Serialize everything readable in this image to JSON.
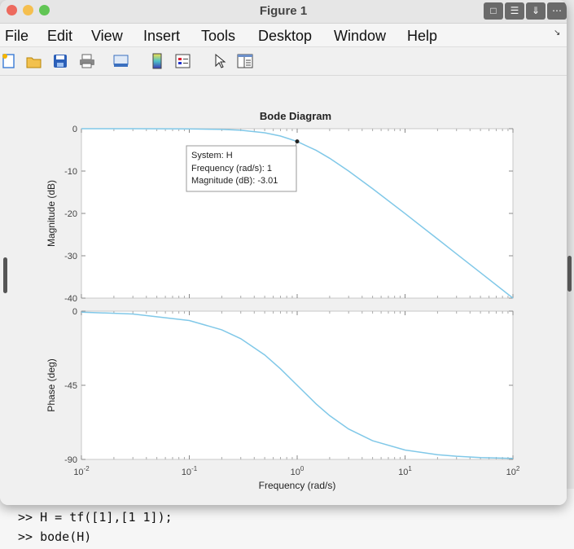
{
  "window": {
    "title": "Figure 1",
    "traffic_lights": [
      "#ed6a5e",
      "#f5bf4f",
      "#61c554"
    ],
    "title_buttons": [
      "comment-icon",
      "list-icon",
      "download-icon",
      "more-icon"
    ]
  },
  "menu": [
    "File",
    "Edit",
    "View",
    "Insert",
    "Tools",
    "Desktop",
    "Window",
    "Help"
  ],
  "toolbar_icons": [
    "new-figure-icon",
    "open-file-icon",
    "save-icon",
    "print-icon",
    "link-plot-icon",
    "colorbar-icon",
    "legend-icon",
    "pointer-icon",
    "property-inspector-icon"
  ],
  "chart_data": {
    "type": "line",
    "title": "Bode Diagram",
    "xlabel": "Frequency  (rad/s)",
    "x_scale": "log",
    "xlim": [
      0.01,
      100
    ],
    "x_ticks": [
      {
        "base": "10",
        "exp": "-2"
      },
      {
        "base": "10",
        "exp": "-1"
      },
      {
        "base": "10",
        "exp": "0"
      },
      {
        "base": "10",
        "exp": "1"
      },
      {
        "base": "10",
        "exp": "2"
      }
    ],
    "color": "#80c8e8",
    "grid": false,
    "panels": [
      {
        "ylabel": "Magnitude (dB)",
        "ylim": [
          -40,
          0
        ],
        "y_ticks": [
          "0",
          "-10",
          "-20",
          "-30",
          "-40"
        ],
        "series": [
          {
            "name": "H",
            "x": [
              0.01,
              0.03,
              0.1,
              0.2,
              0.3,
              0.5,
              0.7,
              1,
              1.5,
              2,
              3,
              5,
              10,
              20,
              30,
              50,
              100
            ],
            "y": [
              0,
              0,
              -0.04,
              -0.17,
              -0.37,
              -0.97,
              -1.74,
              -3.01,
              -5.12,
              -6.99,
              -10.0,
              -14.15,
              -20.04,
              -26.03,
              -29.55,
              -33.98,
              -40.0
            ]
          }
        ]
      },
      {
        "ylabel": "Phase (deg)",
        "ylim": [
          -90,
          0
        ],
        "y_ticks": [
          "0",
          "-45",
          "-90"
        ],
        "series": [
          {
            "name": "H",
            "x": [
              0.01,
              0.03,
              0.1,
              0.2,
              0.3,
              0.5,
              0.7,
              1,
              1.5,
              2,
              3,
              5,
              10,
              20,
              30,
              50,
              100
            ],
            "y": [
              -0.57,
              -1.72,
              -5.71,
              -11.31,
              -16.7,
              -26.57,
              -34.99,
              -45,
              -56.31,
              -63.43,
              -71.57,
              -78.69,
              -84.29,
              -87.14,
              -88.09,
              -88.85,
              -89.43
            ]
          }
        ]
      }
    ],
    "datatip": {
      "system": "System: H",
      "frequency": "Frequency (rad/s): 1",
      "magnitude": "Magnitude (dB): -3.01",
      "x": 1,
      "y": -3.01
    }
  },
  "console": {
    "lines": [
      ">> H = tf([1],[1 1]);",
      ">> bode(H)"
    ]
  }
}
